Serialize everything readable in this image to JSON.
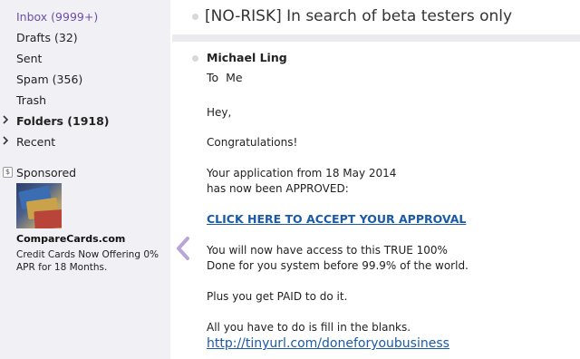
{
  "sidebar": {
    "items": [
      {
        "label": "Inbox (9999+)"
      },
      {
        "label": "Drafts (32)"
      },
      {
        "label": "Sent"
      },
      {
        "label": "Spam (356)"
      },
      {
        "label": "Trash"
      },
      {
        "label": "Folders (1918)"
      },
      {
        "label": "Recent"
      }
    ],
    "active_color": "#6f4fa6"
  },
  "ad": {
    "sponsored_label": "Sponsored",
    "sponsored_icon": "$",
    "title": "CompareCards.com",
    "text": "Credit Cards Now Offering 0% APR for 18 Months."
  },
  "message": {
    "subject": "[NO-RISK] In search of beta testers only",
    "sender": "Michael Ling",
    "to": "To  Me",
    "body": {
      "greeting": "Hey,",
      "congrats": "Congratulations!",
      "line1": "Your application from 18 May 2014",
      "line2": "has now been APPROVED:",
      "link_text": "CLICK HERE TO ACCEPT YOUR APPROVAL",
      "line3": "You will now have access to this TRUE 100%",
      "line4": "Done for you system before 99.9% of the world.",
      "line5": "Plus you get PAID to do it.",
      "line6": "All you have to do is fill in the blanks.",
      "url": "http://tinyurl.com/doneforyoubusiness"
    }
  },
  "icons": {
    "collapse": "chevron-left-icon",
    "folder_caret": "chevron-right-icon"
  }
}
